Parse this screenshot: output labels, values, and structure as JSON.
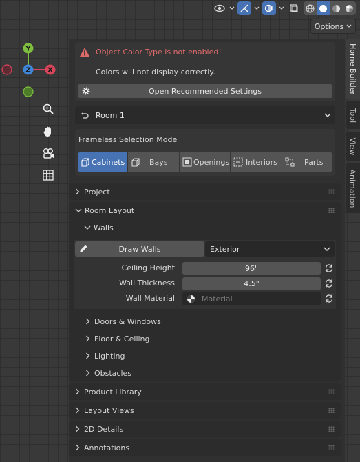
{
  "header": {
    "options_label": "Options",
    "icons": [
      "eye-icon",
      "gizmo-icon",
      "overlay-icon",
      "xray-icon",
      "wireframe-icon",
      "solid-icon",
      "material-icon",
      "rendered-icon"
    ]
  },
  "gizmo": {
    "x": "X",
    "y": "Y",
    "z": "Z"
  },
  "ntabs": [
    "Home Builder",
    "Tool",
    "View",
    "Animation"
  ],
  "warning": {
    "title": "Object Color Type is not enabled!",
    "message": "Colors will not display correctly.",
    "button": "Open Recommended Settings",
    "color": "#e06b6b"
  },
  "room": {
    "selected": "Room 1"
  },
  "selection_mode": {
    "label": "Frameless Selection Mode",
    "modes": [
      "Cabinets",
      "Bays",
      "Openings",
      "Interiors",
      "Parts"
    ],
    "active": "Cabinets"
  },
  "panels": {
    "project": "Project",
    "room_layout": "Room Layout",
    "walls": "Walls",
    "product_library": "Product Library",
    "layout_views": "Layout Views",
    "details_2d": "2D Details",
    "annotations": "Annotations"
  },
  "walls": {
    "draw_button": "Draw Walls",
    "wall_type": "Exterior",
    "ceiling_height_label": "Ceiling Height",
    "ceiling_height": "96\"",
    "wall_thickness_label": "Wall Thickness",
    "wall_thickness": "4.5\"",
    "wall_material_label": "Wall Material",
    "wall_material_placeholder": "Material"
  },
  "subpanels": {
    "doors_windows": "Doors & Windows",
    "floor_ceiling": "Floor & Ceiling",
    "lighting": "Lighting",
    "obstacles": "Obstacles"
  },
  "colors": {
    "accent": "#4772b3",
    "x_axis": "#d9455b",
    "y_axis": "#7fbf3f",
    "z_axis": "#3f86d9"
  }
}
